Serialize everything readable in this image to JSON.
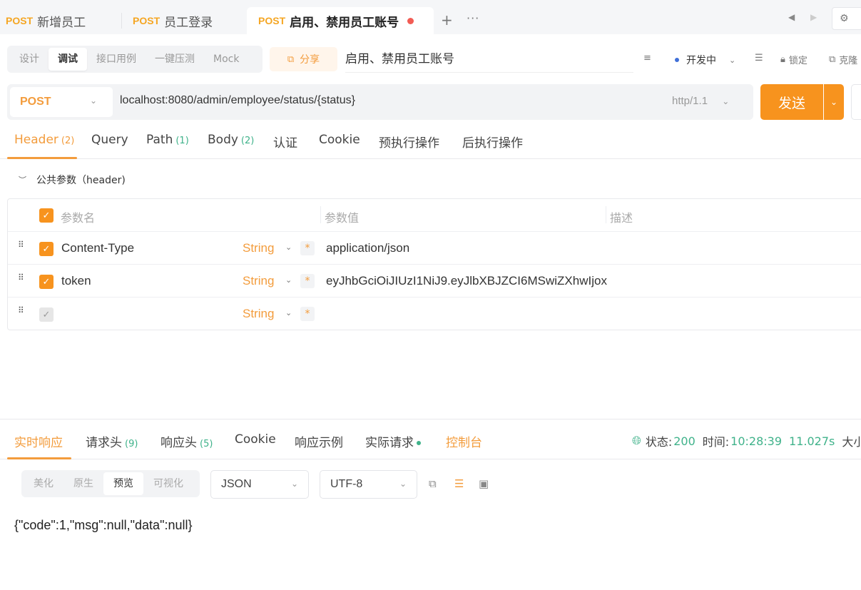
{
  "tabs": [
    {
      "method": "POST",
      "label": "新增员工"
    },
    {
      "method": "POST",
      "label": "员工登录"
    },
    {
      "method": "POST",
      "label": "启用、禁用员工账号"
    }
  ],
  "tabbar": {
    "plus": "+",
    "more": "···",
    "prev": "◀",
    "next": "▶"
  },
  "modes": [
    "设计",
    "调试",
    "接口用例",
    "一键压测",
    "Mock"
  ],
  "share_label": "分享",
  "api_name": "启用、禁用员工账号",
  "toolbar_right": {
    "env": "开发中",
    "lock": "锁定",
    "clone": "克隆"
  },
  "request": {
    "method": "POST",
    "url": "localhost:8080/admin/employee/status/{status}",
    "http_version": "http/1.1",
    "send_label": "发送"
  },
  "req_tabs": [
    {
      "label": "Header",
      "count": "(2)"
    },
    {
      "label": "Query",
      "count": ""
    },
    {
      "label": "Path",
      "count": "(1)"
    },
    {
      "label": "Body",
      "count": "(2)"
    },
    {
      "label": "认证",
      "count": ""
    },
    {
      "label": "Cookie",
      "count": ""
    },
    {
      "label": "预执行操作",
      "count": ""
    },
    {
      "label": "后执行操作",
      "count": ""
    }
  ],
  "common_params_label": "公共参数（header)",
  "param_headers": {
    "name": "参数名",
    "value": "参数值",
    "desc": "描述"
  },
  "params": [
    {
      "name": "Content-Type",
      "type": "String",
      "value": "application/json"
    },
    {
      "name": "token",
      "type": "String",
      "value": "eyJhbGciOiJIUzI1NiJ9.eyJlbXBJZCI6MSwiZXhwIjox"
    },
    {
      "name": "",
      "type": "String",
      "value": ""
    }
  ],
  "resp_tabs": [
    {
      "label": "实时响应",
      "count": ""
    },
    {
      "label": "请求头",
      "count": "(9)"
    },
    {
      "label": "响应头",
      "count": "(5)"
    },
    {
      "label": "Cookie",
      "count": ""
    },
    {
      "label": "响应示例",
      "count": ""
    },
    {
      "label": "实际请求",
      "count": ""
    },
    {
      "label": "控制台",
      "count": ""
    }
  ],
  "status": {
    "status_label": "状态:",
    "status_code": "200",
    "time_label": "时间:",
    "time": "10:28:39",
    "duration": "11.027s",
    "size_label": "大小"
  },
  "view_modes": [
    "美化",
    "原生",
    "预览",
    "可视化"
  ],
  "format": "JSON",
  "encoding": "UTF-8",
  "response_body": "{\"code\":1,\"msg\":null,\"data\":null}",
  "colors": {
    "accent": "#f7931e",
    "method": "#f5a623",
    "success": "#3fb28a"
  }
}
